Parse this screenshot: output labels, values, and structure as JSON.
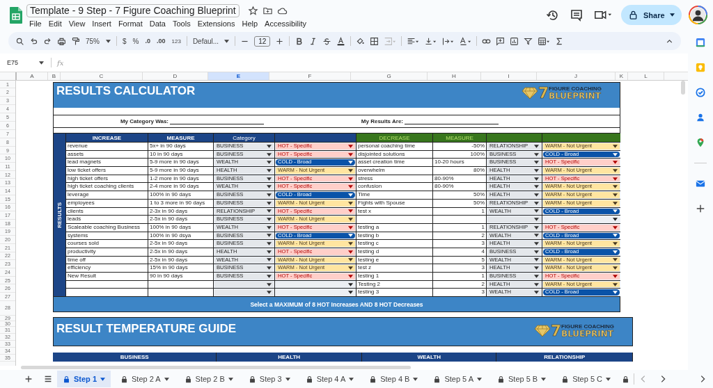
{
  "document": {
    "title": "Template - 9 Step - 7 Figure Coaching Blueprint"
  },
  "menu": [
    "File",
    "Edit",
    "View",
    "Insert",
    "Format",
    "Data",
    "Tools",
    "Extensions",
    "Help",
    "Accessibility"
  ],
  "share_button": "Share",
  "toolbar": {
    "zoom": "75%",
    "currency": "$",
    "percent": "%",
    "decrease_decimals": ".0",
    "increase_decimals": ".00",
    "number_format": "123",
    "font": "Defaul...",
    "font_size": "12"
  },
  "name_box": "E75",
  "formula_label": "fx",
  "columns": [
    {
      "label": "A",
      "selected": false
    },
    {
      "label": "B",
      "selected": false
    },
    {
      "label": "C",
      "selected": false
    },
    {
      "label": "D",
      "selected": false
    },
    {
      "label": "E",
      "selected": true
    },
    {
      "label": "F",
      "selected": false
    },
    {
      "label": "G",
      "selected": false
    },
    {
      "label": "H",
      "selected": false
    },
    {
      "label": "I",
      "selected": false
    },
    {
      "label": "J",
      "selected": false
    },
    {
      "label": "K",
      "selected": false
    },
    {
      "label": "L",
      "selected": false
    }
  ],
  "rows": [
    "1",
    "2",
    "3",
    "4",
    "5",
    "6",
    "7",
    "8",
    "9",
    "10",
    "11",
    "12",
    "13",
    "14",
    "15",
    "16",
    "17",
    "18",
    "19",
    "20",
    "21",
    "22",
    "23",
    "24",
    "25",
    "26",
    "27",
    "28",
    "29",
    "30",
    "31",
    "32",
    "33",
    "34",
    "35"
  ],
  "calculator": {
    "title": "RESULTS CALCULATOR",
    "logo": {
      "number": "7",
      "top": "FIGURE COACHING",
      "bottom": "BLUEPRINT"
    },
    "category_label": "My Category Was:",
    "results_label": "My Results Are:",
    "side_label": "RESULTS",
    "increase_headers": [
      "INCREASE",
      "MEASURE",
      "Category"
    ],
    "decrease_headers": [
      "DECREASE",
      "MEASURE"
    ],
    "increase_rows": [
      {
        "item": "revenue",
        "measure": "5x+ in 90 days",
        "category": "BUSINESS",
        "temperature": {
          "kind": "hot",
          "label": "HOT - Specific"
        }
      },
      {
        "item": "assets",
        "measure": "10 in 90 days",
        "category": "BUSINESS",
        "temperature": {
          "kind": "hot",
          "label": "HOT - Specific"
        }
      },
      {
        "item": "lead magnets",
        "measure": "5-9 more in 90 days",
        "category": "WEALTH",
        "temperature": {
          "kind": "cold",
          "label": "COLD - Broad"
        }
      },
      {
        "item": "low ticket offers",
        "measure": "5-9 more in 90 days",
        "category": "HEALTH",
        "temperature": {
          "kind": "warm",
          "label": "WARM - Not Urgent"
        }
      },
      {
        "item": "high ticket offers",
        "measure": "1-2 more in 90 days",
        "category": "BUSINESS",
        "temperature": {
          "kind": "hot",
          "label": "HOT - Specific"
        }
      },
      {
        "item": "high ticket coaching clients",
        "measure": "2-4 more in 90 days",
        "category": "WEALTH",
        "temperature": {
          "kind": "hot",
          "label": "HOT - Specific"
        }
      },
      {
        "item": "leverage",
        "measure": "100% in 90 days",
        "category": "BUSINESS",
        "temperature": {
          "kind": "cold",
          "label": "COLD - Broad"
        }
      },
      {
        "item": "employees",
        "measure": "1 to 3 more in 90 days",
        "category": "BUSINESS",
        "temperature": {
          "kind": "warm",
          "label": "WARM - Not Urgent"
        }
      },
      {
        "item": "clients",
        "measure": "2-3x in 90 days",
        "category": "RELATIONSHIP",
        "temperature": {
          "kind": "hot",
          "label": "HOT - Specific"
        }
      },
      {
        "item": "leads",
        "measure": "2-5x in 90 days",
        "category": "BUSINESS",
        "temperature": {
          "kind": "warm",
          "label": "WARM - Not Urgent"
        }
      },
      {
        "item": "Scaleable coaching Business",
        "measure": "100% in 90 days",
        "category": "WEALTH",
        "temperature": {
          "kind": "hot",
          "label": "HOT - Specific"
        }
      },
      {
        "item": "systems",
        "measure": "100% in 90 dsya",
        "category": "BUSINESS",
        "temperature": {
          "kind": "cold",
          "label": "COLD - Broad"
        }
      },
      {
        "item": "courses sold",
        "measure": "2-5x in 90 days",
        "category": "BUSINESS",
        "temperature": {
          "kind": "warm",
          "label": "WARM - Not Urgent"
        }
      },
      {
        "item": "productivity",
        "measure": "2-5x in 90 days",
        "category": "HEALTH",
        "temperature": {
          "kind": "hot",
          "label": "HOT - Specific"
        }
      },
      {
        "item": "time off",
        "measure": "2-5x in 90 days",
        "category": "WEALTH",
        "temperature": {
          "kind": "warm",
          "label": "WARM - Not Urgent"
        }
      },
      {
        "item": "efficiency",
        "measure": "15% in 90 days",
        "category": "BUSINESS",
        "temperature": {
          "kind": "warm",
          "label": "WARM - Not Urgent"
        }
      },
      {
        "item": "New Result",
        "measure": "90 in 90 days",
        "category": "BUSINESS",
        "temperature": {
          "kind": "hot",
          "label": "HOT - Specific"
        }
      },
      {
        "temperature": {
          "kind": "empty"
        }
      },
      {
        "temperature": {
          "kind": "empty"
        }
      }
    ],
    "decrease_rows": [
      {
        "item": "personal coaching time",
        "measure": "-50%",
        "measure_right_aligned": true,
        "category": "RELATIONSHIP",
        "temperature": {
          "kind": "warm",
          "label": "WARM - Not Urgent"
        }
      },
      {
        "item": "disjointed solutions",
        "measure": "100%",
        "measure_right_aligned": true,
        "category": "BUSINESS",
        "temperature": {
          "kind": "cold",
          "label": "COLD - Broad"
        }
      },
      {
        "item": "asset creation time",
        "measure": "10-20 hours",
        "category": "BUSINESS",
        "temperature": {
          "kind": "hot",
          "label": "HOT - Specific"
        }
      },
      {
        "item": "overwhelm",
        "measure": "80%",
        "measure_right_aligned": true,
        "category": "HEALTH",
        "temperature": {
          "kind": "warm",
          "label": "WARM - Not Urgent"
        }
      },
      {
        "item": "stress",
        "measure": "80-90%",
        "category": "HEALTH",
        "temperature": {
          "kind": "hot",
          "label": "HOT - Specific"
        }
      },
      {
        "item": "confusion",
        "measure": "80-90%",
        "category": "HEALTH",
        "temperature": {
          "kind": "warm",
          "label": "WARM - Not Urgent"
        }
      },
      {
        "item": "Time",
        "measure": "50%",
        "measure_right_aligned": true,
        "category": "HEALTH",
        "temperature": {
          "kind": "warm",
          "label": "WARM - Not Urgent"
        }
      },
      {
        "item": "Fights with Spouse",
        "measure": "50%",
        "measure_right_aligned": true,
        "category": "RELATIONSHIP",
        "temperature": {
          "kind": "warm",
          "label": "WARM - Not Urgent"
        }
      },
      {
        "item": "test x",
        "measure": "1",
        "measure_right_aligned": true,
        "category": "WEALTH",
        "temperature": {
          "kind": "cold",
          "label": "COLD - Broad"
        }
      },
      {
        "temperature": {
          "kind": "empty"
        }
      },
      {
        "item": "testing a",
        "measure": "1",
        "measure_right_aligned": true,
        "category": "RELATIONSHIP",
        "temperature": {
          "kind": "hot",
          "label": "HOT - Specific"
        }
      },
      {
        "item": "testing b",
        "measure": "2",
        "measure_right_aligned": true,
        "category": "WEALTH",
        "temperature": {
          "kind": "cold",
          "label": "COLD - Broad"
        }
      },
      {
        "item": "testing c",
        "measure": "3",
        "measure_right_aligned": true,
        "category": "HEALTH",
        "temperature": {
          "kind": "warm",
          "label": "WARM - Not Urgent"
        }
      },
      {
        "item": "testing d",
        "measure": "4",
        "measure_right_aligned": true,
        "category": "BUSINESS",
        "temperature": {
          "kind": "cold",
          "label": "COLD - Broad"
        }
      },
      {
        "item": "testing e",
        "measure": "5",
        "measure_right_aligned": true,
        "category": "WEALTH",
        "temperature": {
          "kind": "warm",
          "label": "WARM - Not Urgent"
        }
      },
      {
        "item": "test z",
        "measure": "3",
        "measure_right_aligned": true,
        "category": "HEALTH",
        "temperature": {
          "kind": "warm",
          "label": "WARM - Not Urgent"
        }
      },
      {
        "item": "testing 1",
        "measure": "1",
        "measure_right_aligned": true,
        "category": "BUSINESS",
        "temperature": {
          "kind": "hot",
          "label": "HOT - Specific"
        }
      },
      {
        "item": "Testing 2",
        "measure": "2",
        "measure_right_aligned": true,
        "category": "HEALTH",
        "temperature": {
          "kind": "warm",
          "label": "WARM - Not Urgent"
        }
      },
      {
        "item": "testing 3",
        "measure": "3",
        "measure_right_aligned": true,
        "category": "WEALTH",
        "temperature": {
          "kind": "cold",
          "label": "COLD - Broad"
        }
      }
    ],
    "footer": "Select a MAXIMUM of 8 HOT Increases AND 8 HOT Decreases"
  },
  "guide": {
    "title": "RESULT TEMPERATURE GUIDE",
    "logo": {
      "number": "7",
      "top": "FIGURE COACHING",
      "bottom": "BLUEPRINT"
    },
    "columns": [
      "BUSINESS",
      "HEALTH",
      "WEALTH",
      "RELATIONSHIP"
    ]
  },
  "sheet_tabs": [
    {
      "label": "Step 1",
      "selected": true
    },
    {
      "label": "Step 2 A",
      "selected": false
    },
    {
      "label": "Step 2 B",
      "selected": false
    },
    {
      "label": "Step 3",
      "selected": false
    },
    {
      "label": "Step 4 A",
      "selected": false
    },
    {
      "label": "Step 4 B",
      "selected": false
    },
    {
      "label": "Step 5 A",
      "selected": false
    },
    {
      "label": "Step 5 B",
      "selected": false
    },
    {
      "label": "Step 5 C",
      "selected": false
    }
  ]
}
